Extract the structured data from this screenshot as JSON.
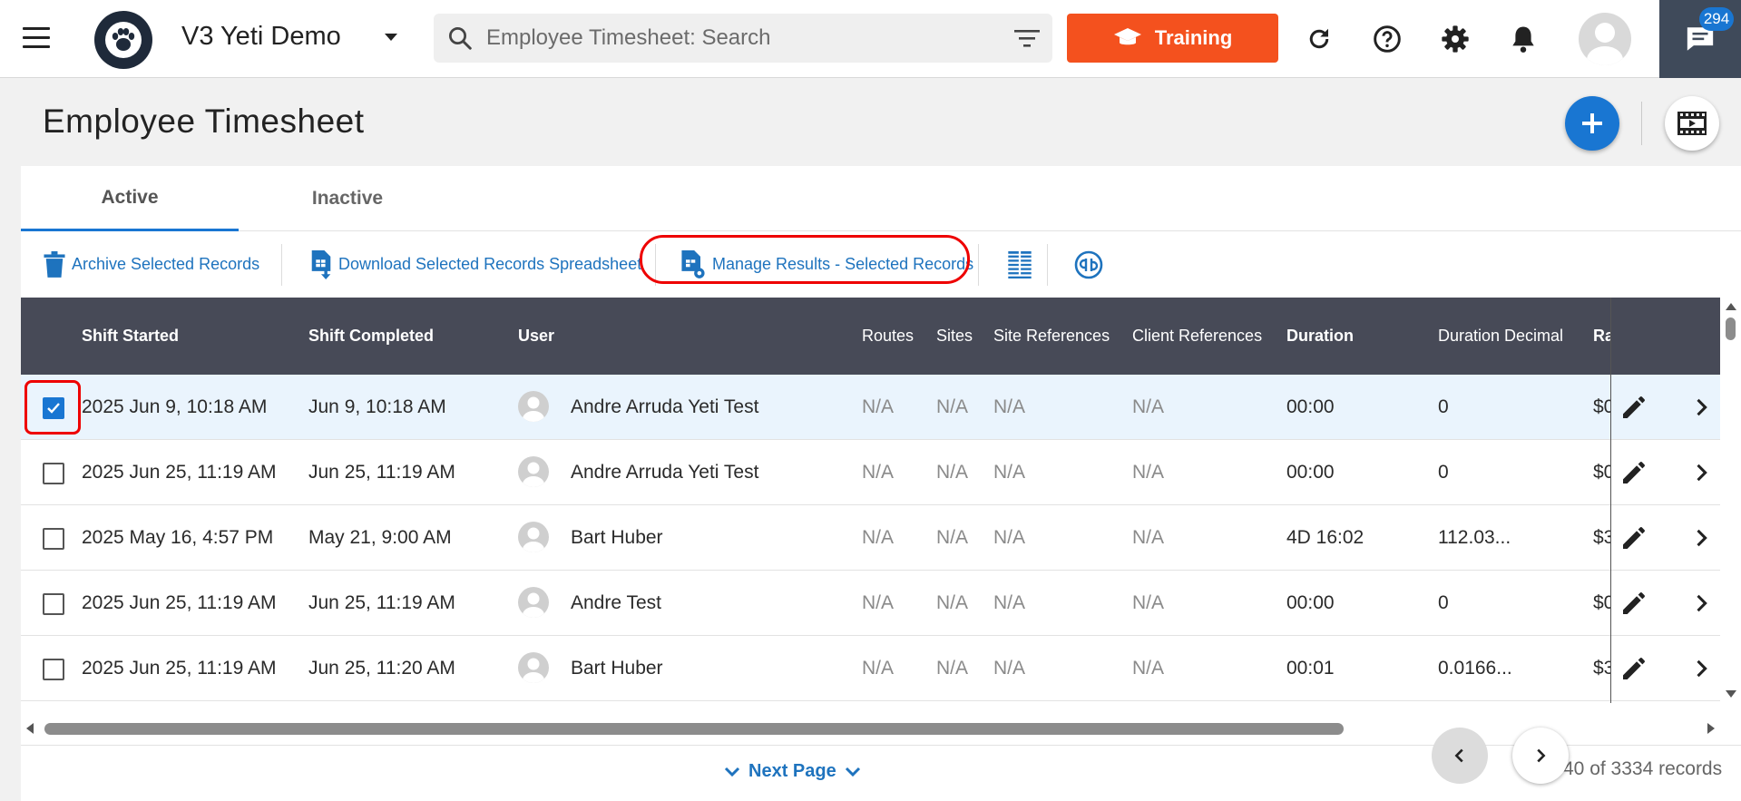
{
  "app": {
    "name": "V3 Yeti Demo",
    "search_placeholder": "Employee Timesheet: Search",
    "training_label": "Training",
    "chat_badge": "294"
  },
  "page": {
    "title": "Employee Timesheet"
  },
  "tabs": [
    {
      "label": "Active",
      "active": true
    },
    {
      "label": "Inactive",
      "active": false
    }
  ],
  "toolbar": {
    "archive": "Archive Selected Records",
    "download": "Download Selected Records Spreadsheet",
    "manage": "Manage Results - Selected Records"
  },
  "columns": {
    "shift_started": "Shift Started",
    "shift_completed": "Shift Completed",
    "user": "User",
    "routes": "Routes",
    "sites": "Sites",
    "site_references": "Site References",
    "client_references": "Client References",
    "duration": "Duration",
    "duration_decimal": "Duration Decimal",
    "rate": "Ra"
  },
  "rows": [
    {
      "checked": true,
      "shift_started": "2025 Jun 9, 10:18 AM",
      "shift_completed": "Jun 9, 10:18 AM",
      "user": "Andre Arruda Yeti Test",
      "routes": "N/A",
      "sites": "N/A",
      "site_references": "N/A",
      "client_references": "N/A",
      "duration": "00:00",
      "duration_decimal": "0",
      "rate": "$0"
    },
    {
      "checked": false,
      "shift_started": "2025 Jun 25, 11:19 AM",
      "shift_completed": "Jun 25, 11:19 AM",
      "user": "Andre Arruda Yeti Test",
      "routes": "N/A",
      "sites": "N/A",
      "site_references": "N/A",
      "client_references": "N/A",
      "duration": "00:00",
      "duration_decimal": "0",
      "rate": "$0"
    },
    {
      "checked": false,
      "shift_started": "2025 May 16, 4:57 PM",
      "shift_completed": "May 21, 9:00 AM",
      "user": "Bart Huber",
      "routes": "N/A",
      "sites": "N/A",
      "site_references": "N/A",
      "client_references": "N/A",
      "duration": "4D 16:02",
      "duration_decimal": "112.03...",
      "rate": "$3"
    },
    {
      "checked": false,
      "shift_started": "2025 Jun 25, 11:19 AM",
      "shift_completed": "Jun 25, 11:19 AM",
      "user": "Andre Test",
      "routes": "N/A",
      "sites": "N/A",
      "site_references": "N/A",
      "client_references": "N/A",
      "duration": "00:00",
      "duration_decimal": "0",
      "rate": "$0"
    },
    {
      "checked": false,
      "shift_started": "2025 Jun 25, 11:19 AM",
      "shift_completed": "Jun 25, 11:20 AM",
      "user": "Bart Huber",
      "routes": "N/A",
      "sites": "N/A",
      "site_references": "N/A",
      "client_references": "N/A",
      "duration": "00:01",
      "duration_decimal": "0.0166...",
      "rate": "$3"
    }
  ],
  "footer": {
    "next_page": "Next Page",
    "record_count": "40 of 3334 records"
  },
  "colors": {
    "accent": "#1976d2",
    "training": "#f4511e",
    "header_bg": "#474a57",
    "link": "#1e73be",
    "highlight": "#e00000"
  },
  "icons": [
    "menu-icon",
    "paw-icon",
    "caret-down-icon",
    "search-icon",
    "filter-icon",
    "graduation-cap-icon",
    "refresh-icon",
    "help-icon",
    "gear-icon",
    "bell-icon",
    "avatar-icon",
    "chat-icon",
    "plus-icon",
    "video-icon",
    "trash-icon",
    "download-file-icon",
    "file-settings-icon",
    "columns-icon",
    "quickbooks-icon",
    "pencil-icon",
    "chevron-right-icon",
    "chevron-left-icon",
    "chevron-down-icon"
  ]
}
